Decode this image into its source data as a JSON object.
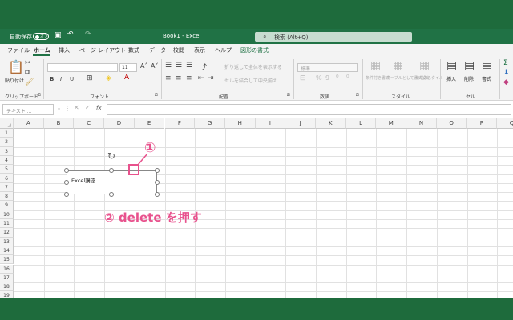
{
  "titlebar": {
    "autosave_label": "自動保存",
    "autosave_state": "オフ",
    "title": "Book1 - Excel",
    "search_placeholder": "検索 (Alt+Q)"
  },
  "tabs": [
    "ファイル",
    "ホーム",
    "挿入",
    "ページ レイアウト",
    "数式",
    "データ",
    "校閲",
    "表示",
    "ヘルプ",
    "図形の書式"
  ],
  "active_tab": "ホーム",
  "ribbon": {
    "clipboard": {
      "paste_label": "貼り付け",
      "group_label": "クリップボード"
    },
    "font": {
      "size": "11",
      "group_label": "フォント",
      "bold": "B",
      "italic": "I",
      "underline": "U"
    },
    "alignment": {
      "wrap_label": "折り返して全体を表示する",
      "merge_label": "セルを結合して中央揃え",
      "group_label": "配置"
    },
    "number": {
      "format": "標準",
      "group_label": "数値"
    },
    "styles": {
      "conditional": "条件付き書式",
      "table": "テーブルとして書式設定",
      "cell": "セルのスタイル",
      "group_label": "スタイル"
    },
    "cells": {
      "insert": "挿入",
      "delete": "削除",
      "format": "書式",
      "group_label": "セル"
    }
  },
  "formula_bar": {
    "namebox": "テキスト ...",
    "fx": "fx"
  },
  "columns": [
    "A",
    "B",
    "C",
    "D",
    "E",
    "F",
    "G",
    "H",
    "I",
    "J",
    "K",
    "L",
    "M",
    "N",
    "O",
    "P",
    "Q"
  ],
  "rows": [
    "1",
    "2",
    "3",
    "4",
    "5",
    "6",
    "7",
    "8",
    "9",
    "10",
    "11",
    "12",
    "13",
    "14",
    "15",
    "16",
    "17",
    "18",
    "19"
  ],
  "shape_text": "Excel講座",
  "annotations": {
    "step1": "①",
    "step2": "② delete を押す"
  },
  "colors": {
    "excel_green": "#207245",
    "annotation_pink": "#e8528d"
  }
}
